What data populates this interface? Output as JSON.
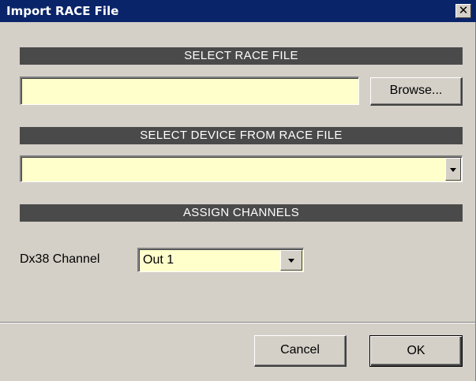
{
  "window": {
    "title": "Import RACE File",
    "close_glyph": "✕"
  },
  "sections": {
    "select_file": "SELECT RACE FILE",
    "select_device": "SELECT DEVICE FROM RACE FILE",
    "assign_channels": "ASSIGN CHANNELS"
  },
  "file": {
    "path_value": "",
    "browse_label": "Browse..."
  },
  "device": {
    "selected": ""
  },
  "channels": {
    "label": "Dx38 Channel",
    "selected": "Out 1"
  },
  "footer": {
    "cancel_label": "Cancel",
    "ok_label": "OK"
  },
  "colors": {
    "title_bar": "#0a246a",
    "dialog_bg": "#d4d0c8",
    "section_bar": "#4a4a4a",
    "field_bg": "#ffffcc"
  },
  "icons": {
    "close": "close-icon",
    "dropdown": "chevron-down-icon"
  }
}
